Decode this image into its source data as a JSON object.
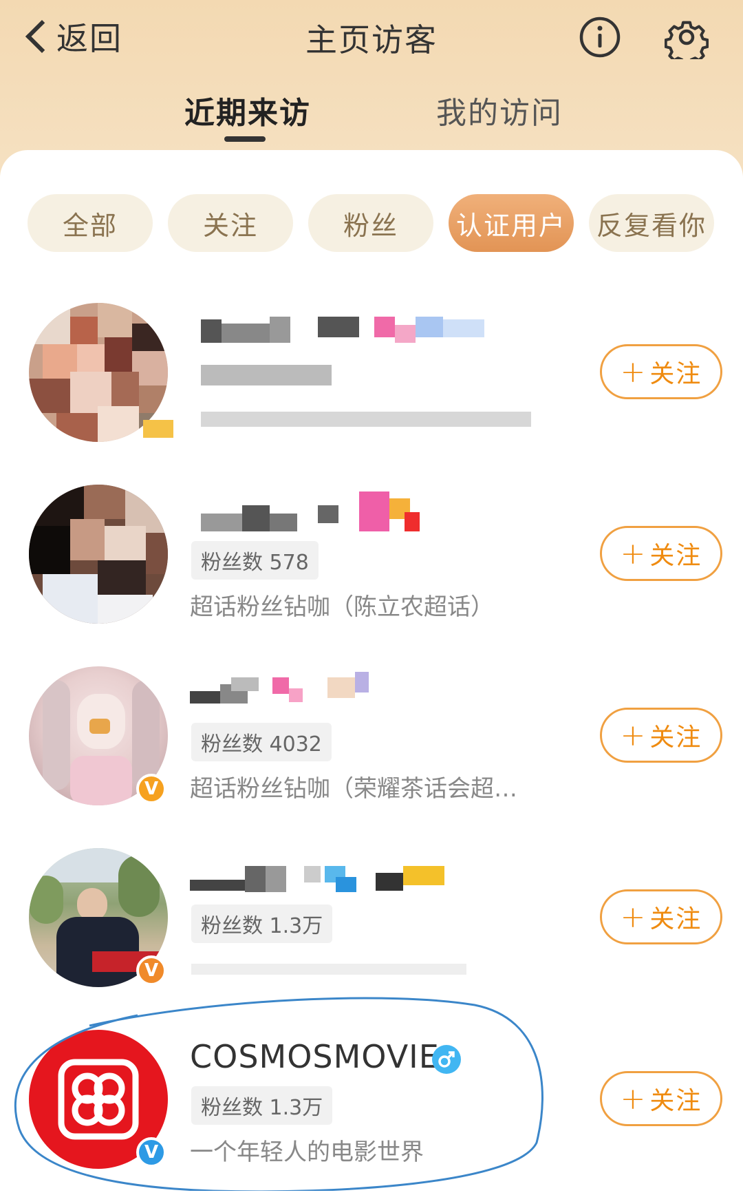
{
  "header": {
    "back_label": "返回",
    "title": "主页访客",
    "tabs": [
      {
        "label": "近期来访",
        "active": true
      },
      {
        "label": "我的访问",
        "active": false
      }
    ]
  },
  "filters": [
    {
      "label": "全部",
      "active": false
    },
    {
      "label": "关注",
      "active": false
    },
    {
      "label": "粉丝",
      "active": false
    },
    {
      "label": "认证用户",
      "active": true
    },
    {
      "label": "反复看你",
      "active": false
    }
  ],
  "visitors": [
    {
      "name": "",
      "fans": "",
      "desc": "",
      "follow_label": "关注"
    },
    {
      "name": "",
      "fans": "粉丝数 578",
      "desc": "超话粉丝钻咖（陈立农超话）",
      "follow_label": "关注"
    },
    {
      "name": "",
      "fans": "粉丝数 4032",
      "desc": "超话粉丝钻咖（荣耀茶话会超…",
      "follow_label": "关注"
    },
    {
      "name": "",
      "fans": "粉丝数 1.3万",
      "desc": "",
      "follow_label": "关注"
    },
    {
      "name": "COSMOSMOVIE",
      "fans": "粉丝数 1.3万",
      "desc": "一个年轻人的电影世界",
      "follow_label": "关注"
    }
  ],
  "colors": {
    "accent": "#ef8b10",
    "chip_active": "#e29455",
    "header_bg": "#f3d9b2",
    "verify_orange": "#f6a11f",
    "verify_blue": "#2d9ae5",
    "brand_red": "#e5161e"
  },
  "icons": {
    "back": "chevron-left-icon",
    "info": "info-icon",
    "settings": "gear-icon",
    "gender": "male-icon"
  }
}
